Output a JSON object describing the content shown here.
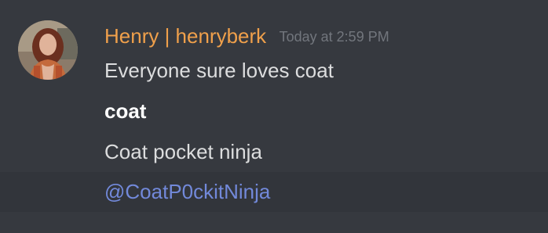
{
  "message": {
    "author": "Henry | henryberk",
    "timestamp": "Today at 2:59 PM",
    "lines": [
      "Everyone sure loves coat",
      "coat",
      "Coat pocket ninja"
    ],
    "mention": "@CoatP0ckitNinja"
  },
  "colors": {
    "background": "#36393f",
    "username": "#f0a04b",
    "timestamp": "#72767d",
    "text": "#dcddde",
    "mention": "#7289da",
    "highlight_row": "#32353b"
  }
}
